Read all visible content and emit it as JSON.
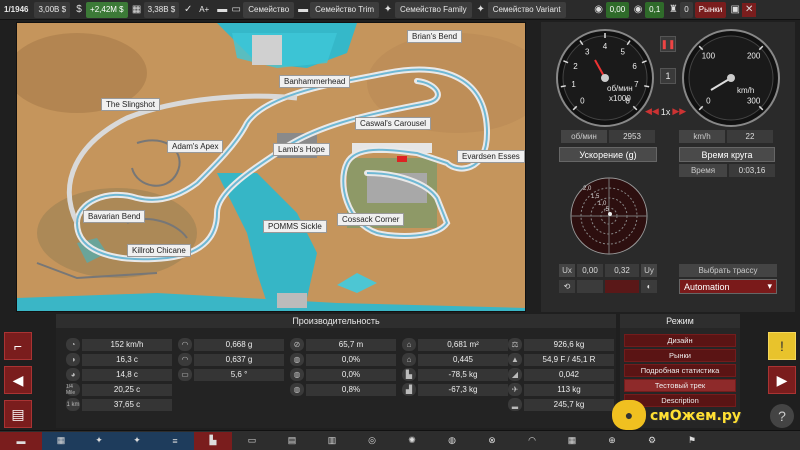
{
  "topbar": {
    "date": "1/1946",
    "money": "3,00B $",
    "income": "+2,42M $",
    "spending": "3,38B $",
    "grade": "A+",
    "tabs": [
      "Семейство",
      "Семейство Trim",
      "Семейство Family",
      "Семейство Variant"
    ],
    "counter1": "0,00",
    "counter2": "0,1",
    "counter3": "0",
    "markets": "Рынки"
  },
  "map": {
    "labels": [
      "Brian's Bend",
      "Banhammerhead",
      "The Slingshot",
      "Caswal's Carousel",
      "Adam's Apex",
      "Lamb's Hope",
      "Evardsen Esses",
      "Bavarian Bend",
      "POMMS Sickle",
      "Cossack Corner",
      "Killrob Chicane"
    ]
  },
  "gauges": {
    "rpm_unit_1": "об/мин",
    "rpm_unit_2": "x1000",
    "speed_unit": "km/h",
    "rpm_ticks": [
      "0",
      "1",
      "2",
      "3",
      "4",
      "5",
      "6",
      "7",
      "8"
    ],
    "speed_ticks": [
      "0",
      "100",
      "200",
      "300"
    ],
    "gear": "1",
    "speed_multiplier": "1x",
    "rpm_label": "об/мин",
    "rpm_value": "2953",
    "kmh_label": "km/h",
    "kmh_value": "22",
    "accel_label": "Ускорение (g)",
    "laptime_label": "Время круга",
    "time_label": "Время",
    "time_value": "0:03,16",
    "gforce_ticks": [
      "2,0",
      "1,5",
      "1,0",
      ",5"
    ],
    "ux_label": "Ux",
    "ux_value": "0,00",
    "uy_value": "0,32",
    "uy_label": "Uy",
    "select_track": "Выбрать трассу",
    "track_name": "Automation"
  },
  "performance": {
    "title": "Производительность",
    "col1": [
      "152 km/h",
      "16,3 c",
      "14,8 c",
      "20,25 c",
      "37,65 c"
    ],
    "col1_icon_labels": [
      "1/4 Mile",
      "1 km"
    ],
    "col2": [
      "0,668 g",
      "0,637 g",
      "5,6 °"
    ],
    "col3": [
      "65,7 m",
      "0,0%",
      "0,0%",
      "0,8%"
    ],
    "col4": [
      "0,681 m²",
      "0,445",
      "-78,5 kg",
      "-67,3 kg"
    ],
    "col5": [
      "926,6 kg",
      "54,9 F / 45,1 R",
      "0,042",
      "113 kg",
      "245,7 kg"
    ]
  },
  "mode": {
    "title": "Режим",
    "buttons": [
      "Дизайн",
      "Рынки",
      "Подробная статистика",
      "Тестовый трек",
      "Description"
    ]
  },
  "watermark": "смОжем.ру",
  "colors": {
    "accent_red": "#7a1d1d",
    "active_red": "#8e2a2a",
    "income_green": "#3c7a37",
    "help_yellow": "#e8c32c"
  }
}
